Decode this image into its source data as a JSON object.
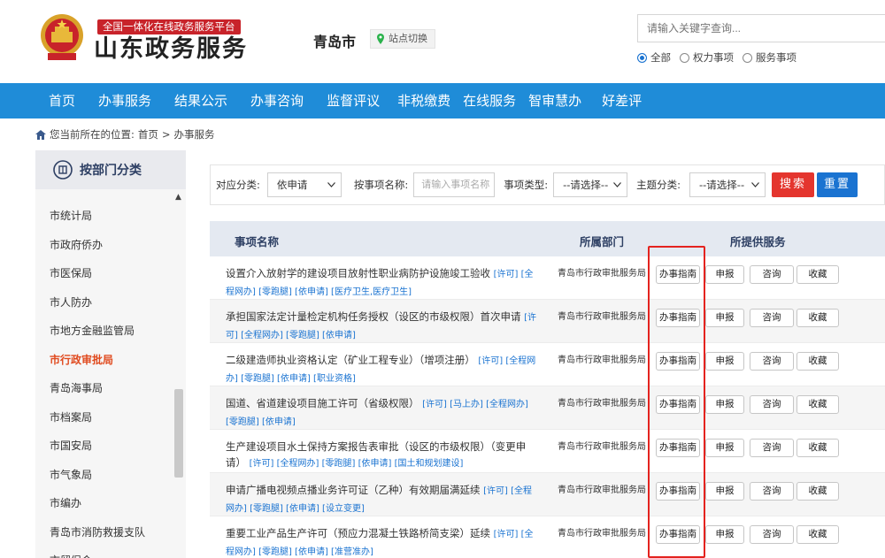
{
  "header": {
    "platform_tag": "全国一体化在线政务服务平台",
    "brand": "山东政务服务",
    "city": "青岛市",
    "site_switch": "站点切换",
    "search_placeholder": "请输入关键字查询...",
    "scope_options": [
      "全部",
      "权力事项",
      "服务事项"
    ],
    "scope_selected": "全部"
  },
  "nav": [
    "首页",
    "办事服务",
    "结果公示",
    "办事咨询",
    "监督评议",
    "非税缴费",
    "在线服务",
    "智审慧办",
    "好差评"
  ],
  "breadcrumb": {
    "prefix": "您当前所在的位置:",
    "items": [
      "首页",
      ">",
      "办事服务"
    ]
  },
  "sidebar": {
    "title": "按部门分类",
    "items": [
      "市统计局",
      "市政府侨办",
      "市医保局",
      "市人防办",
      "市地方金融监管局",
      "市行政审批局",
      "青岛海事局",
      "市档案局",
      "市国安局",
      "市气象局",
      "市编办",
      "青岛市消防救援支队",
      "市贸促会"
    ],
    "active": "市行政审批局"
  },
  "filter": {
    "category_label": "对应分类:",
    "category_value": "依申请",
    "name_label": "按事项名称:",
    "name_placeholder": "请输入事项名称",
    "type_label": "事项类型:",
    "type_value": "--请选择--",
    "theme_label": "主题分类:",
    "theme_value": "--请选择--",
    "search_button": "搜索",
    "reset_button": "重置"
  },
  "table": {
    "headers": [
      "事项名称",
      "所属部门",
      "所提供服务"
    ],
    "service_buttons": [
      "办事指南",
      "申报",
      "咨询",
      "收藏"
    ],
    "rows": [
      {
        "name": "设置介入放射学的建设项目放射性职业病防护设施竣工验收",
        "tags": "[许可] [全程网办] [零跑腿] [依申请] [医疗卫生,医疗卫生]",
        "dept": "青岛市行政审批服务局"
      },
      {
        "name": "承担国家法定计量检定机构任务授权（设区的市级权限）首次申请",
        "tags": "[许可] [全程网办] [零跑腿] [依申请]",
        "dept": "青岛市行政审批服务局"
      },
      {
        "name": "二级建造师执业资格认定（矿业工程专业）（增项注册）",
        "tags": "[许可] [全程网办] [零跑腿] [依申请] [职业资格]",
        "dept": "青岛市行政审批服务局"
      },
      {
        "name": "国道、省道建设项目施工许可（省级权限）",
        "tags": "[许可] [马上办] [全程网办] [零跑腿] [依申请]",
        "dept": "青岛市行政审批服务局"
      },
      {
        "name": "生产建设项目水土保持方案报告表审批（设区的市级权限）（变更申请）",
        "tags": "[许可] [全程网办] [零跑腿] [依申请] [国土和规划建设]",
        "dept": "青岛市行政审批服务局"
      },
      {
        "name": "申请广播电视频点播业务许可证（乙种）有效期届满延续",
        "tags": "[许可] [全程网办] [零跑腿] [依申请] [设立变更]",
        "dept": "青岛市行政审批服务局"
      },
      {
        "name": "重要工业产品生产许可（预应力混凝土铁路桥简支梁）延续",
        "tags": "[许可] [全程网办] [零跑腿] [依申请] [准营准办]",
        "dept": "青岛市行政审批服务局"
      }
    ]
  },
  "colors": {
    "nav_bg": "#1f8cd8",
    "brand_red": "#c8232a",
    "search_red": "#e4352e",
    "reset_blue": "#1a73d1",
    "highlight_red": "#e4231f",
    "active_orange": "#e04a1e"
  }
}
